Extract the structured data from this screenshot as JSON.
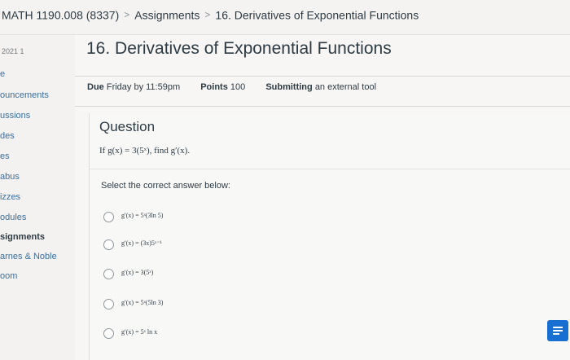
{
  "breadcrumb": {
    "items": [
      "MATH 1190.008 (8337)",
      "Assignments",
      "16. Derivatives of Exponential Functions"
    ],
    "separator": ">"
  },
  "sidebar": {
    "term": "2021 1",
    "items": [
      {
        "label": "e"
      },
      {
        "label": "ouncements"
      },
      {
        "label": "ussions"
      },
      {
        "label": "des"
      },
      {
        "label": "es"
      },
      {
        "label": "abus"
      },
      {
        "label": "izzes"
      },
      {
        "label": "odules"
      },
      {
        "label": "signments"
      },
      {
        "label": "arnes & Noble"
      },
      {
        "label": "oom"
      }
    ]
  },
  "page": {
    "title": "16. Derivatives of Exponential Functions",
    "due_label": "Due",
    "due_value": "Friday by 11:59pm",
    "points_label": "Points",
    "points_value": "100",
    "submitting_label": "Submitting",
    "submitting_value": "an external tool"
  },
  "question": {
    "heading": "Question",
    "text": "If g(x) = 3(5ˣ), find g′(x).",
    "instruction": "Select the correct answer below:",
    "options": [
      {
        "text": "g′(x) = 5ˣ(3ln 5)"
      },
      {
        "text": "g′(x) = (3x)5ˣ⁻¹"
      },
      {
        "text": "g′(x) = 3(5ˣ)"
      },
      {
        "text": "g′(x) = 5ˣ(5ln 3)"
      },
      {
        "text": "g′(x) = 5ˣ ln x"
      }
    ]
  },
  "chat_button": {
    "icon": "chat-icon",
    "color": "#176fd1"
  }
}
